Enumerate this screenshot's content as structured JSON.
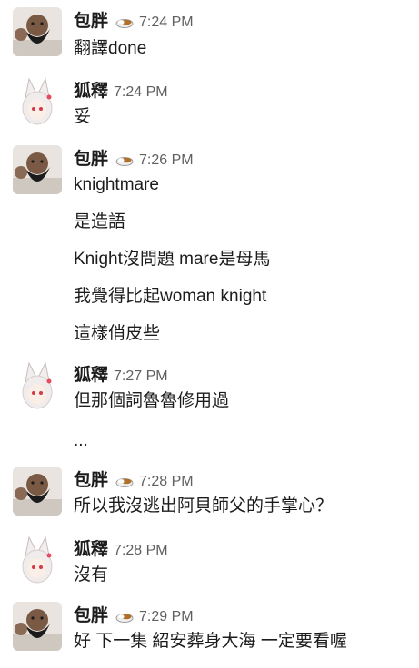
{
  "messages": [
    {
      "user": "包胖",
      "status_icon": "curry-rice-icon",
      "time": "7:24 PM",
      "lines": [
        "翻譯done"
      ]
    },
    {
      "user": "狐釋",
      "time": "7:24 PM",
      "lines": [
        "妥"
      ]
    },
    {
      "user": "包胖",
      "status_icon": "curry-rice-icon",
      "time": "7:26 PM",
      "lines": [
        "knightmare",
        "是造語",
        "Knight沒問題 mare是母馬",
        "我覺得比起woman knight",
        "這樣俏皮些"
      ]
    },
    {
      "user": "狐釋",
      "time": "7:27 PM",
      "lines": [
        "但那個詞魯魯修用過",
        "..."
      ]
    },
    {
      "user": "包胖",
      "status_icon": "curry-rice-icon",
      "time": "7:28 PM",
      "lines": [
        "所以我沒逃出阿貝師父的手掌心？"
      ]
    },
    {
      "user": "狐釋",
      "time": "7:28 PM",
      "lines": [
        "沒有"
      ]
    },
    {
      "user": "包胖",
      "status_icon": "curry-rice-icon",
      "time": "7:29 PM",
      "lines": [
        "好 下一集 紹安葬身大海 一定要看喔"
      ]
    }
  ]
}
